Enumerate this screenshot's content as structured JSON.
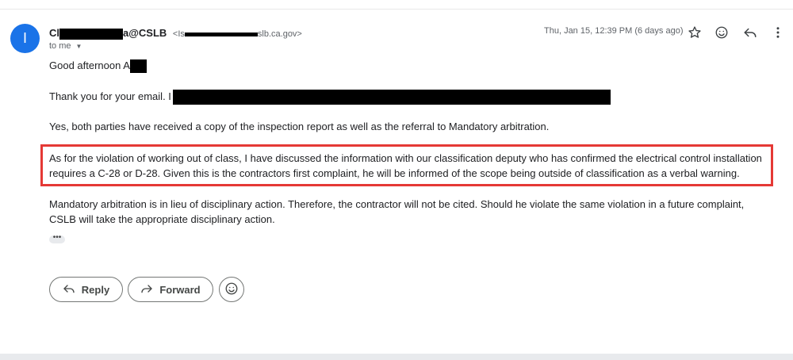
{
  "header": {
    "avatar_letter": "I",
    "sender_prefix": "Cl",
    "sender_suffix": "a@CSLB",
    "email_prefix": "<Is",
    "email_suffix": "slb.ca.gov>",
    "to_label": "to me",
    "date": "Thu, Jan 15, 12:39 PM (6 days ago)",
    "icons": [
      "star-icon",
      "emoji-icon",
      "reply-icon",
      "more-vert-icon"
    ]
  },
  "body": {
    "greeting": "Good afternoon A",
    "thanks": "Thank you for your email. I",
    "p3": "Yes, both parties have received a copy of the inspection report as well as the referral to Mandatory arbitration.",
    "p4": "As for the violation of working out of class, I have discussed the information with our classification deputy who has confirmed the electrical control installation requires a C-28 or D-28. Given this is the contractors first complaint, he will be informed of the scope being outside of classification as a verbal warning.",
    "p5": "Mandatory arbitration is in lieu of disciplinary action. Therefore, the contractor will not be cited. Should he violate the same violation in a future complaint, CSLB will take the appropriate disciplinary action.",
    "ellipsis": "•••"
  },
  "actions": {
    "reply_label": "Reply",
    "forward_label": "Forward"
  },
  "colors": {
    "avatar": "#1a73e8",
    "highlight_border": "#e53935",
    "redaction": "#000000"
  }
}
